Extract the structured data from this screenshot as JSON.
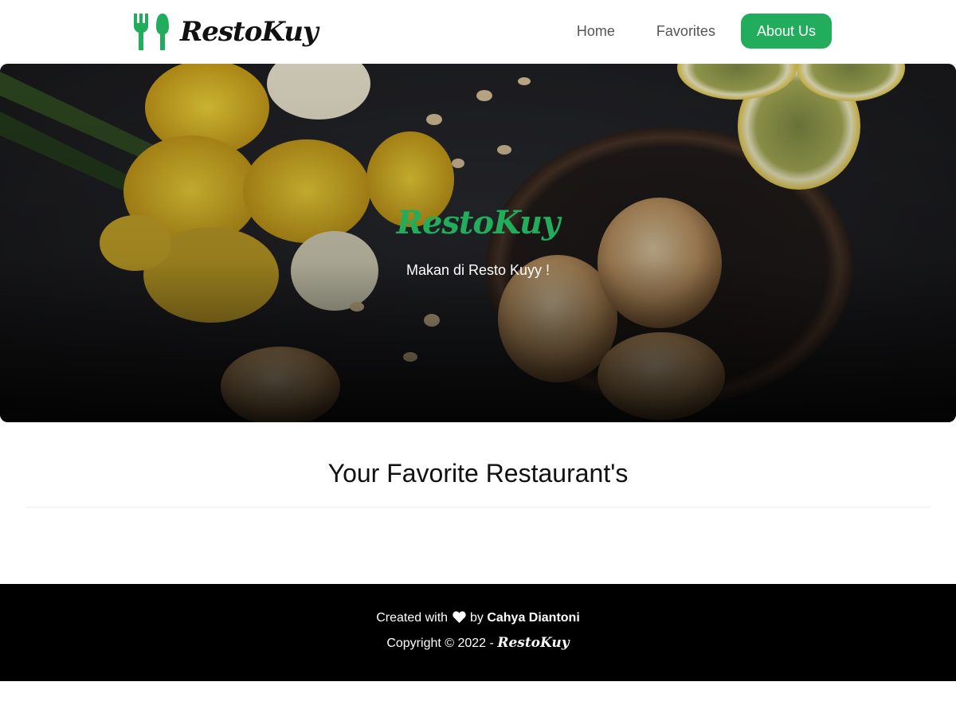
{
  "header": {
    "brand_name": "RestoKuy",
    "brand_icon": "fork-spoon-icon",
    "nav": [
      {
        "label": "Home"
      },
      {
        "label": "Favorites"
      },
      {
        "label": "About Us"
      }
    ]
  },
  "hero": {
    "title": "RestoKuy",
    "tagline": "Makan di Resto Kuyy !"
  },
  "main": {
    "section_title": "Your Favorite Restaurant's"
  },
  "footer": {
    "created_prefix": "Created with",
    "heart_icon": "heart-icon",
    "by_text": "by",
    "author": "Cahya Diantoni",
    "copyright": "Copyright © 2022 -",
    "brand": "RestoKuy"
  },
  "colors": {
    "accent": "#21ad5b",
    "footer_bg": "#000000",
    "nav_text": "#555555"
  }
}
